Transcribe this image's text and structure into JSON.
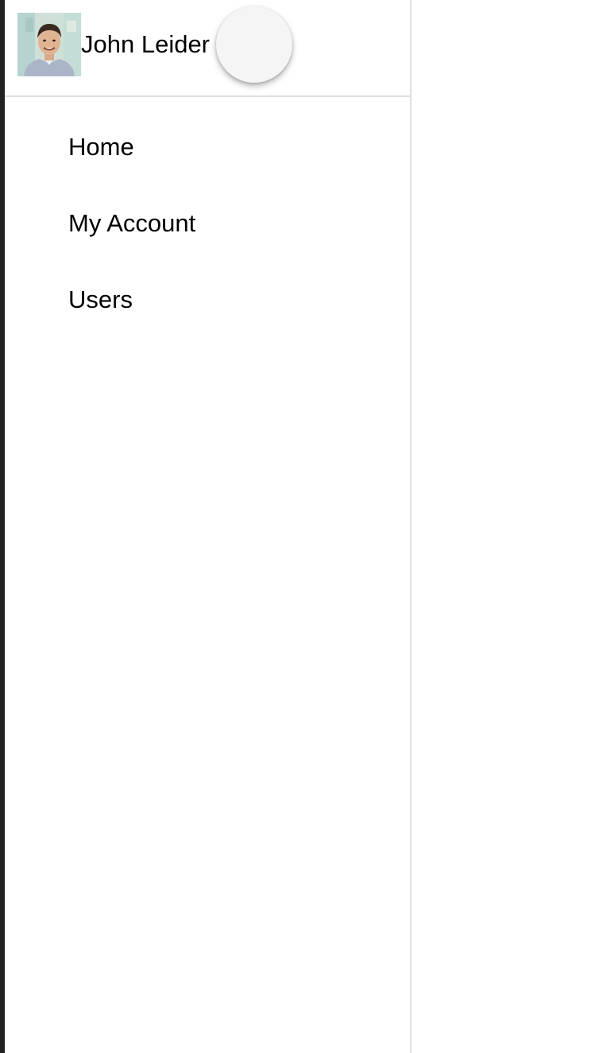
{
  "user": {
    "name": "John Leider",
    "avatar_icon": "person-photo-avatar"
  },
  "fab": {
    "icon": "blank-circle-button"
  },
  "nav": {
    "items": [
      {
        "label": "Home"
      },
      {
        "label": "My Account"
      },
      {
        "label": "Users"
      }
    ]
  },
  "colors": {
    "background": "#ffffff",
    "divider": "#e0e0e0",
    "left_edge": "#212121",
    "fab": "#f5f5f5",
    "text": "#000000"
  }
}
